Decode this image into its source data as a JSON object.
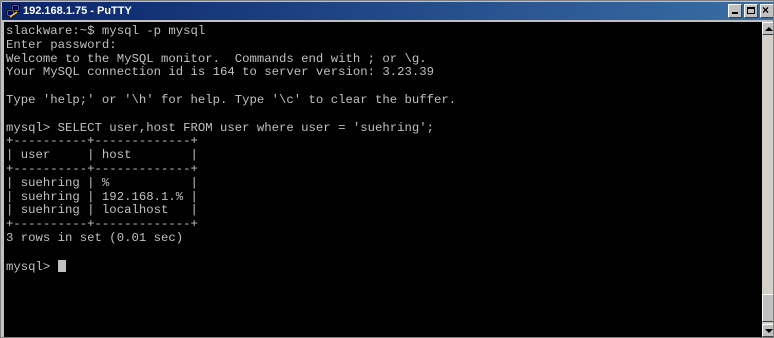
{
  "window": {
    "title": "192.168.1.75 - PuTTY",
    "icon": "putty-icon",
    "title_bar_color": "#0a246a"
  },
  "window_controls": {
    "minimize_icon": "minimize-icon",
    "maximize_icon": "maximize-icon",
    "close_icon": "close-icon",
    "close_glyph": "×"
  },
  "terminal": {
    "background": "#000000",
    "foreground": "#c0c0c0",
    "lines": [
      "slackware:~$ mysql -p mysql",
      "Enter password:",
      "Welcome to the MySQL monitor.  Commands end with ; or \\g.",
      "Your MySQL connection id is 164 to server version: 3.23.39",
      "",
      "Type 'help;' or '\\h' for help. Type '\\c' to clear the buffer.",
      "",
      "mysql> SELECT user,host FROM user where user = 'suehring';",
      "+----------+-------------+",
      "| user     | host        |",
      "+----------+-------------+",
      "| suehring | %           |",
      "| suehring | 192.168.1.% |",
      "| suehring | localhost   |",
      "+----------+-------------+",
      "3 rows in set (0.01 sec)",
      ""
    ],
    "prompt": "mysql> "
  },
  "scrollbar": {
    "up_icon": "scroll-up-arrow-icon",
    "down_icon": "scroll-down-arrow-icon"
  }
}
